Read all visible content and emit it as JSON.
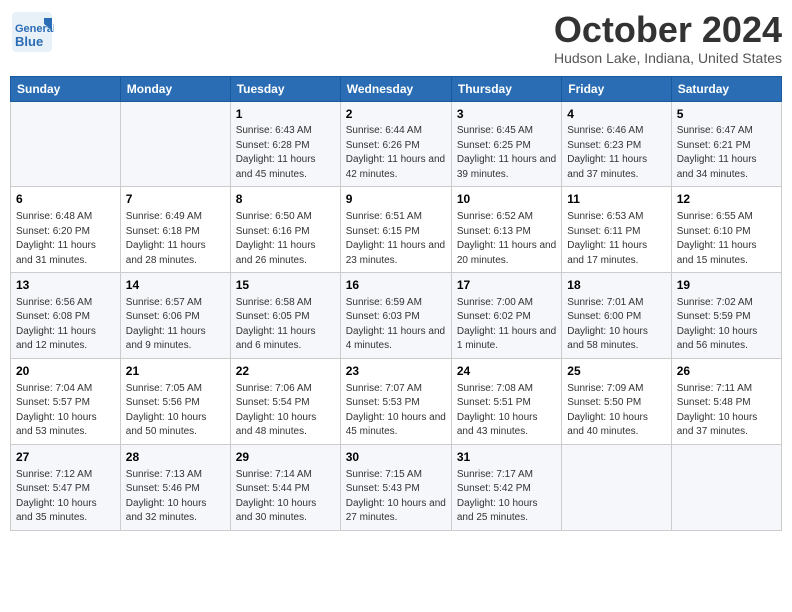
{
  "header": {
    "logo_line1": "General",
    "logo_line2": "Blue",
    "month": "October 2024",
    "location": "Hudson Lake, Indiana, United States"
  },
  "weekdays": [
    "Sunday",
    "Monday",
    "Tuesday",
    "Wednesday",
    "Thursday",
    "Friday",
    "Saturday"
  ],
  "weeks": [
    [
      {
        "day": "",
        "content": ""
      },
      {
        "day": "",
        "content": ""
      },
      {
        "day": "1",
        "content": "Sunrise: 6:43 AM\nSunset: 6:28 PM\nDaylight: 11 hours and 45 minutes."
      },
      {
        "day": "2",
        "content": "Sunrise: 6:44 AM\nSunset: 6:26 PM\nDaylight: 11 hours and 42 minutes."
      },
      {
        "day": "3",
        "content": "Sunrise: 6:45 AM\nSunset: 6:25 PM\nDaylight: 11 hours and 39 minutes."
      },
      {
        "day": "4",
        "content": "Sunrise: 6:46 AM\nSunset: 6:23 PM\nDaylight: 11 hours and 37 minutes."
      },
      {
        "day": "5",
        "content": "Sunrise: 6:47 AM\nSunset: 6:21 PM\nDaylight: 11 hours and 34 minutes."
      }
    ],
    [
      {
        "day": "6",
        "content": "Sunrise: 6:48 AM\nSunset: 6:20 PM\nDaylight: 11 hours and 31 minutes."
      },
      {
        "day": "7",
        "content": "Sunrise: 6:49 AM\nSunset: 6:18 PM\nDaylight: 11 hours and 28 minutes."
      },
      {
        "day": "8",
        "content": "Sunrise: 6:50 AM\nSunset: 6:16 PM\nDaylight: 11 hours and 26 minutes."
      },
      {
        "day": "9",
        "content": "Sunrise: 6:51 AM\nSunset: 6:15 PM\nDaylight: 11 hours and 23 minutes."
      },
      {
        "day": "10",
        "content": "Sunrise: 6:52 AM\nSunset: 6:13 PM\nDaylight: 11 hours and 20 minutes."
      },
      {
        "day": "11",
        "content": "Sunrise: 6:53 AM\nSunset: 6:11 PM\nDaylight: 11 hours and 17 minutes."
      },
      {
        "day": "12",
        "content": "Sunrise: 6:55 AM\nSunset: 6:10 PM\nDaylight: 11 hours and 15 minutes."
      }
    ],
    [
      {
        "day": "13",
        "content": "Sunrise: 6:56 AM\nSunset: 6:08 PM\nDaylight: 11 hours and 12 minutes."
      },
      {
        "day": "14",
        "content": "Sunrise: 6:57 AM\nSunset: 6:06 PM\nDaylight: 11 hours and 9 minutes."
      },
      {
        "day": "15",
        "content": "Sunrise: 6:58 AM\nSunset: 6:05 PM\nDaylight: 11 hours and 6 minutes."
      },
      {
        "day": "16",
        "content": "Sunrise: 6:59 AM\nSunset: 6:03 PM\nDaylight: 11 hours and 4 minutes."
      },
      {
        "day": "17",
        "content": "Sunrise: 7:00 AM\nSunset: 6:02 PM\nDaylight: 11 hours and 1 minute."
      },
      {
        "day": "18",
        "content": "Sunrise: 7:01 AM\nSunset: 6:00 PM\nDaylight: 10 hours and 58 minutes."
      },
      {
        "day": "19",
        "content": "Sunrise: 7:02 AM\nSunset: 5:59 PM\nDaylight: 10 hours and 56 minutes."
      }
    ],
    [
      {
        "day": "20",
        "content": "Sunrise: 7:04 AM\nSunset: 5:57 PM\nDaylight: 10 hours and 53 minutes."
      },
      {
        "day": "21",
        "content": "Sunrise: 7:05 AM\nSunset: 5:56 PM\nDaylight: 10 hours and 50 minutes."
      },
      {
        "day": "22",
        "content": "Sunrise: 7:06 AM\nSunset: 5:54 PM\nDaylight: 10 hours and 48 minutes."
      },
      {
        "day": "23",
        "content": "Sunrise: 7:07 AM\nSunset: 5:53 PM\nDaylight: 10 hours and 45 minutes."
      },
      {
        "day": "24",
        "content": "Sunrise: 7:08 AM\nSunset: 5:51 PM\nDaylight: 10 hours and 43 minutes."
      },
      {
        "day": "25",
        "content": "Sunrise: 7:09 AM\nSunset: 5:50 PM\nDaylight: 10 hours and 40 minutes."
      },
      {
        "day": "26",
        "content": "Sunrise: 7:11 AM\nSunset: 5:48 PM\nDaylight: 10 hours and 37 minutes."
      }
    ],
    [
      {
        "day": "27",
        "content": "Sunrise: 7:12 AM\nSunset: 5:47 PM\nDaylight: 10 hours and 35 minutes."
      },
      {
        "day": "28",
        "content": "Sunrise: 7:13 AM\nSunset: 5:46 PM\nDaylight: 10 hours and 32 minutes."
      },
      {
        "day": "29",
        "content": "Sunrise: 7:14 AM\nSunset: 5:44 PM\nDaylight: 10 hours and 30 minutes."
      },
      {
        "day": "30",
        "content": "Sunrise: 7:15 AM\nSunset: 5:43 PM\nDaylight: 10 hours and 27 minutes."
      },
      {
        "day": "31",
        "content": "Sunrise: 7:17 AM\nSunset: 5:42 PM\nDaylight: 10 hours and 25 minutes."
      },
      {
        "day": "",
        "content": ""
      },
      {
        "day": "",
        "content": ""
      }
    ]
  ]
}
